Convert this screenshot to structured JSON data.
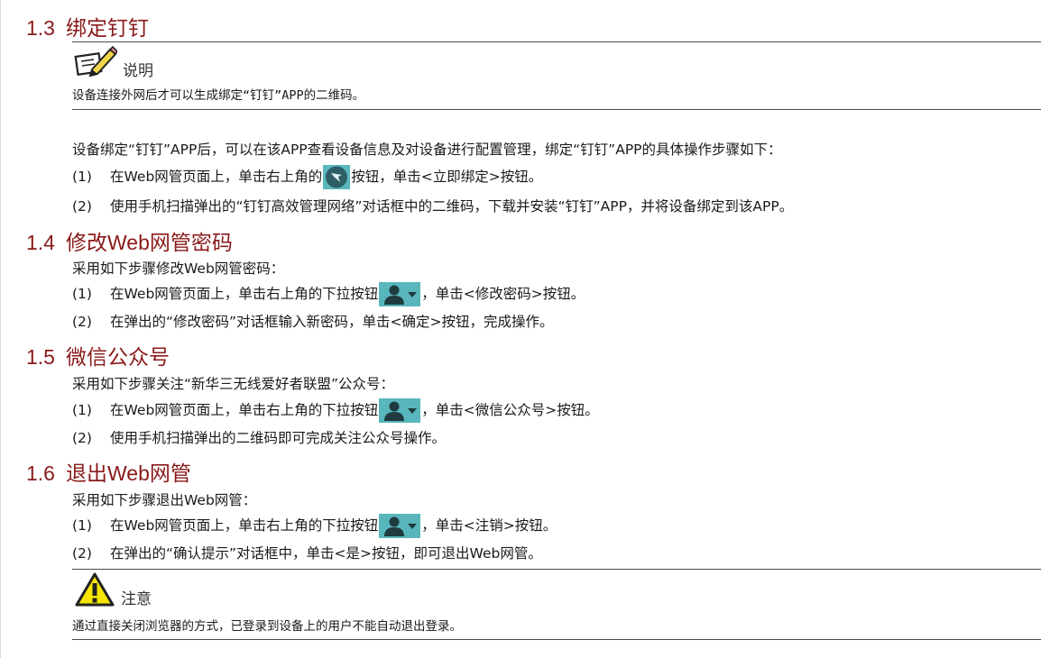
{
  "sections": [
    {
      "number": "1.3",
      "title": "绑定钉钉",
      "note_label": "说明",
      "note_text": "设备连接外网后才可以生成绑定“钉钉”APP的二维码。",
      "intro": "设备绑定“钉钉”APP后，可以在该APP查看设备信息及对设备进行配置管理，绑定“钉钉”APP的具体操作步骤如下：",
      "steps": [
        {
          "idx": "(1)",
          "before": "在Web网管页面上，单击右上角的",
          "after": "按钮，单击<立即绑定>按钮。"
        },
        {
          "idx": "(2)",
          "text": "使用手机扫描弹出的“钉钉高效管理网络”对话框中的二维码，下载并安装“钉钉”APP，并将设备绑定到该APP。"
        }
      ]
    },
    {
      "number": "1.4",
      "title": "修改Web网管密码",
      "intro": "采用如下步骤修改Web网管密码：",
      "steps": [
        {
          "idx": "(1)",
          "before": "在Web网管页面上，单击右上角的下拉按钮",
          "after": "，单击<修改密码>按钮。"
        },
        {
          "idx": "(2)",
          "text": "在弹出的“修改密码”对话框输入新密码，单击<确定>按钮，完成操作。"
        }
      ]
    },
    {
      "number": "1.5",
      "title": "微信公众号",
      "intro": "采用如下步骤关注“新华三无线爱好者联盟”公众号：",
      "steps": [
        {
          "idx": "(1)",
          "before": "在Web网管页面上，单击右上角的下拉按钮",
          "after": "，单击<微信公众号>按钮。"
        },
        {
          "idx": "(2)",
          "text": "使用手机扫描弹出的二维码即可完成关注公众号操作。"
        }
      ]
    },
    {
      "number": "1.6",
      "title": "退出Web网管",
      "intro": "采用如下步骤退出Web网管：",
      "steps": [
        {
          "idx": "(1)",
          "before": "在Web网管页面上，单击右上角的下拉按钮",
          "after": "，单击<注销>按钮。"
        },
        {
          "idx": "(2)",
          "text": "在弹出的“确认提示”对话框中，单击<是>按钮，即可退出Web网管。"
        }
      ],
      "caution_label": "注意",
      "caution_text": "通过直接关闭浏览器的方式，已登录到设备上的用户不能自动退出登录。"
    }
  ],
  "colors": {
    "heading": "#8a1a1a",
    "button_teal": "#59b6bc",
    "dingtalk_badge": "#4f8f96",
    "caution_yellow": "#f5e500"
  },
  "icons": {
    "note": "note-pencil-icon",
    "caution": "warning-triangle-icon",
    "dingtalk": "dingtalk-icon",
    "user_dropdown": "user-dropdown-icon"
  }
}
